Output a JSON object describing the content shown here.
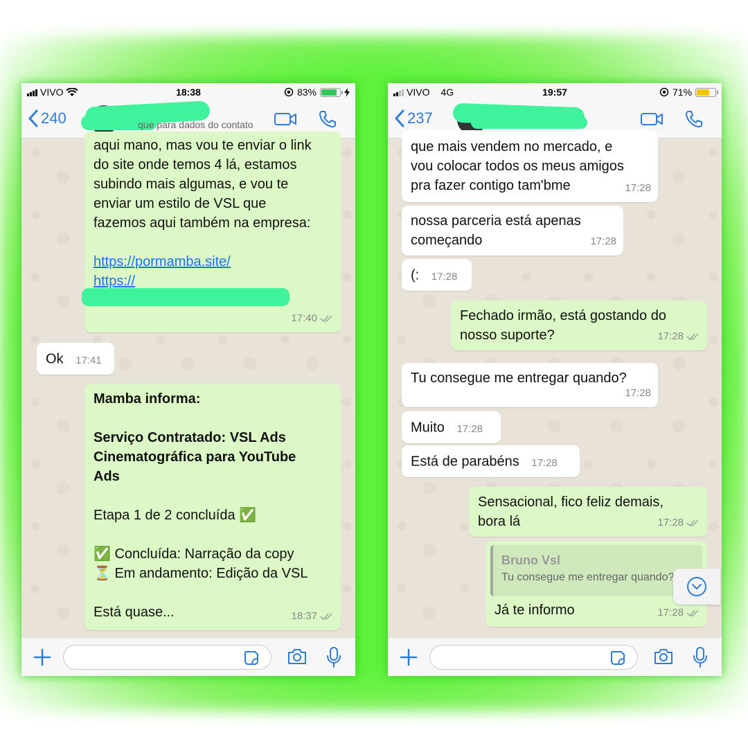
{
  "left": {
    "status": {
      "carrier": "VIVO",
      "network": "",
      "time": "18:38",
      "battery": "83%",
      "battery_color": "#34c759"
    },
    "header": {
      "back_count": "240",
      "contact_subtitle": "que para dados do contato"
    },
    "messages": [
      {
        "dir": "out",
        "lines": "aqui mano, mas vou te enviar o link\ndo site onde temos 4 lá, estamos\nsubindo mais algumas, e vou te\nenviar um estilo de VSL que\nfazemos aqui também na empresa:",
        "link1": "https://pormamba.site/",
        "link2": "https://",
        "time": "17:40"
      },
      {
        "dir": "in",
        "text": "Ok",
        "time": "17:41"
      },
      {
        "dir": "out",
        "title": "Mamba informa:",
        "service": "Serviço Contratado: VSL Ads\nCinematográfica para YouTube\nAds",
        "stage": "Etapa 1 de 2 concluída ✅",
        "done": "✅ Concluída: Narração da copy",
        "progress": "⏳ Em andamento: Edição da VSL",
        "closing": "Está quase...",
        "time": "18:37"
      }
    ]
  },
  "right": {
    "status": {
      "carrier": "VIVO",
      "network": "4G",
      "time": "19:57",
      "battery": "71%",
      "battery_color": "#f5c400"
    },
    "header": {
      "back_count": "237"
    },
    "messages": [
      {
        "dir": "in",
        "text": "que mais vendem no mercado, e\nvou colocar todos os meus amigos\npra fazer contigo tam'bme",
        "time": "17:28"
      },
      {
        "dir": "in",
        "text": "nossa parceria está apenas\ncomeçando",
        "time": "17:28"
      },
      {
        "dir": "in",
        "text": "(:",
        "time": "17:28"
      },
      {
        "dir": "out",
        "text": "Fechado irmão, está gostando do\nnosso suporte?",
        "time": "17:28"
      },
      {
        "dir": "in",
        "text": "Tu consegue me entregar quando?",
        "time": "17:28"
      },
      {
        "dir": "in",
        "text": "Muito",
        "time": "17:28"
      },
      {
        "dir": "in",
        "text": "Está de parabéns",
        "time": "17:28"
      },
      {
        "dir": "out",
        "text": "Sensacional, fico feliz demais,\nbora lá",
        "time": "17:28"
      },
      {
        "dir": "out",
        "quote_name": "Bruno Vsl",
        "quote_text": "Tu consegue me entregar quando?",
        "text": "Já te informo",
        "time": "17:28"
      }
    ]
  },
  "icons": {
    "back": "chevron-left-icon",
    "video": "video-camera-icon",
    "call": "phone-icon",
    "attach": "plus-icon",
    "sticker": "sticker-icon",
    "camera": "camera-icon",
    "mic": "microphone-icon",
    "read": "double-check-icon",
    "scroll": "chevron-down-circle-icon"
  },
  "colors": {
    "accent": "#2f7cd8",
    "outgoing": "#dcf8c6",
    "incoming": "#ffffff",
    "glow": "#5ff23c",
    "redaction": "#3ff29c"
  }
}
